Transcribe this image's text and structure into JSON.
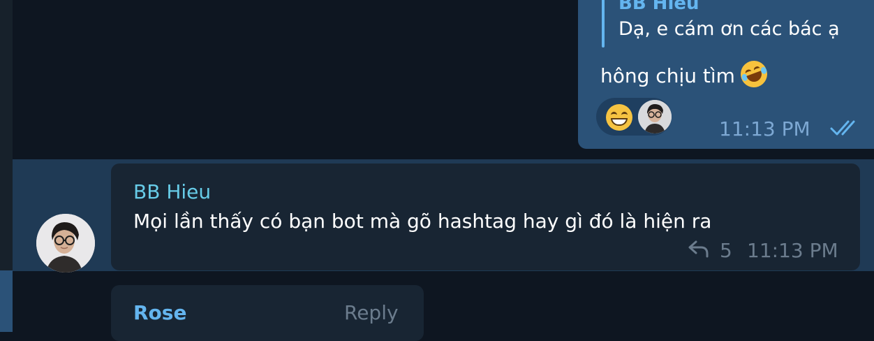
{
  "outgoing_message": {
    "quoted_sender": "BB Hieu",
    "quoted_text": "Dạ, e cám ơn các bác ạ",
    "text": "hông chịu tìm",
    "emoji": "rolling-on-floor-laughing",
    "reaction_emoji": "grinning-face-with-smiling-eyes",
    "time": "11:13 PM",
    "status_icon": "double-check-icon"
  },
  "selected_message": {
    "sender": "BB Hieu",
    "text": "Mọi lần thấy có bạn bot mà gõ hashtag hay gì đó là hiện ra",
    "reply_icon": "reply-arrow-icon",
    "reply_count": "5",
    "time": "11:13 PM",
    "avatar": "user-avatar-bb-hieu"
  },
  "next_message": {
    "sender": "Rose",
    "action": "Reply"
  },
  "colors": {
    "background": "#0e1621",
    "outgoing_bubble": "#2b5278",
    "incoming_bubble": "#182533",
    "selected_row": "#1f3a55",
    "sender_name": "#67cce8",
    "accent": "#64b5ef"
  }
}
